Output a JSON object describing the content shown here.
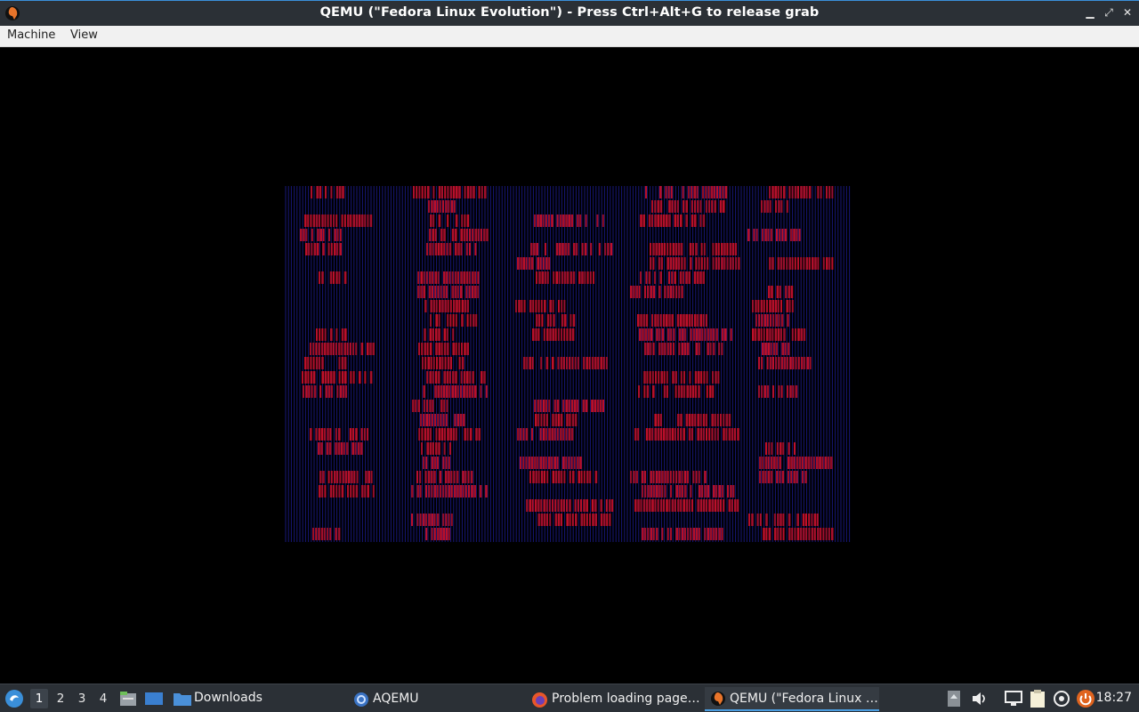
{
  "window": {
    "title": "QEMU (\"Fedora Linux Evolution\") - Press Ctrl+Alt+G to release grab",
    "controls": [
      "minimize",
      "maximize",
      "close"
    ]
  },
  "menubar": {
    "items": [
      "Machine",
      "View"
    ]
  },
  "colors": {
    "titlebar_bg": "#2b3036",
    "accent": "#4a9de0",
    "guest_bg": "#000000",
    "guest_blue_lines": "#1c1c8c",
    "guest_red_blocks": "#c0102a"
  },
  "taskbar": {
    "workspaces": [
      "1",
      "2",
      "3",
      "4"
    ],
    "active_workspace": "1",
    "launchers": [
      "start-menu-icon",
      "file-manager-icon",
      "show-desktop-icon"
    ],
    "folder_label": "Downloads",
    "tasks": [
      {
        "label": "AQEMU",
        "icon": "aqemu-icon",
        "active": false
      },
      {
        "label": "Problem loading page…",
        "icon": "firefox-icon",
        "active": false
      },
      {
        "label": "QEMU (\"Fedora Linux …",
        "icon": "qemu-icon",
        "active": true
      }
    ],
    "tray_icons": [
      "notifications-icon",
      "volume-icon",
      "network-icon",
      "clipboard-icon",
      "updates-icon",
      "power-icon"
    ],
    "clock": "18:27"
  }
}
